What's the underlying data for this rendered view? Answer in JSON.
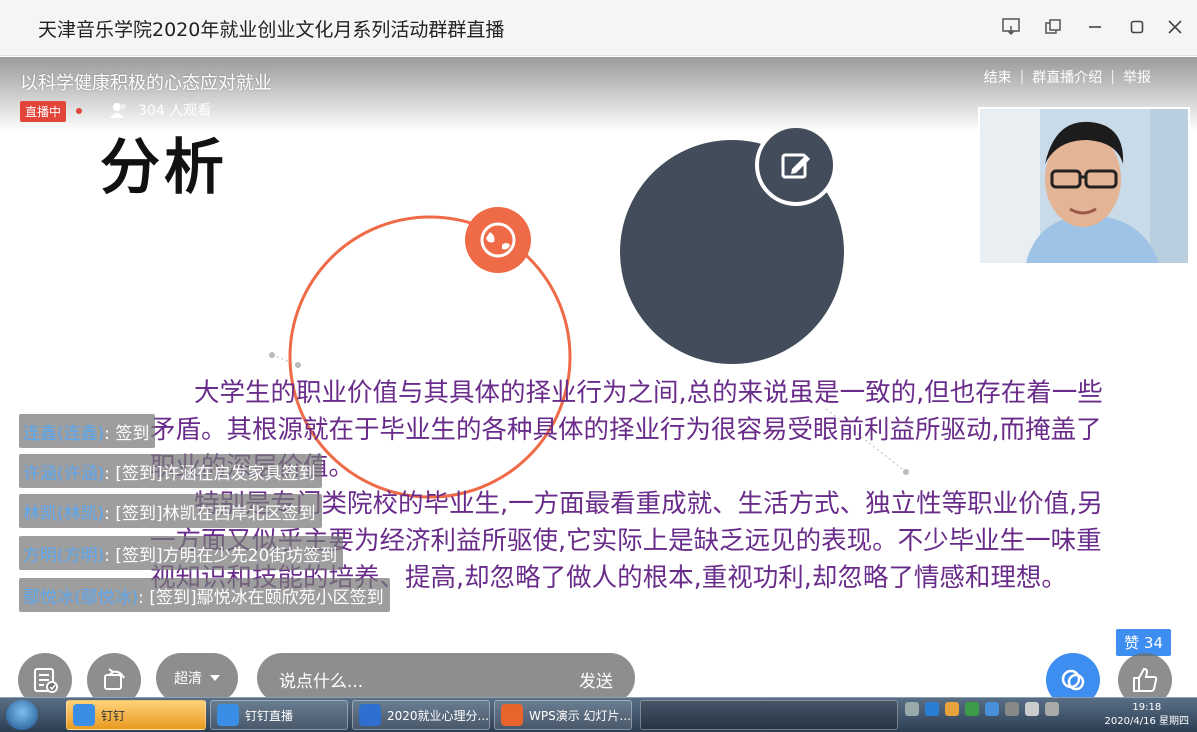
{
  "window": {
    "title": "天津音乐学院2020年就业创业文化月系列活动群群直播"
  },
  "live": {
    "title": "以科学健康积极的心态应对就业",
    "badge": "直播中",
    "viewers": "304 人观看",
    "links": [
      "结束",
      "群直播介绍",
      "举报"
    ],
    "separators": [
      "|",
      "|"
    ]
  },
  "slide": {
    "heading": "分析",
    "paragraphs": [
      "大学生的职业价值与其具体的择业行为之间,总的来说虽是一致的,但也存在着一些矛盾。其根源就在于毕业生的各种具体的择业行为很容易受眼前利益所驱动,而掩盖了职业的深层价值。",
      "特别是专门类院校的毕业生,一方面最看重成就、生活方式、独立性等职业价值,另一方面又似乎主要为经济利益所驱使,它实际上是缺乏远见的表现。不少毕业生一味重视知识和技能的培养、提高,却忽略了做人的根本,重视功利,却忽略了情感和理想。"
    ]
  },
  "chat": [
    {
      "nick": "连鑫(连鑫)",
      "msg": " : 签到"
    },
    {
      "nick": "许涵(许涵)",
      "msg": " : [签到]许涵在启发家具签到"
    },
    {
      "nick": "林凯(林凯)",
      "msg": " : [签到]林凯在西岸北区签到"
    },
    {
      "nick": "方明(方明)",
      "msg": " : [签到]方明在少先20街坊签到"
    },
    {
      "nick": "鄢悦冰(鄢悦冰)",
      "msg": " : [签到]鄢悦冰在颐欣苑小区签到"
    }
  ],
  "controls": {
    "quality": "超清",
    "comment_placeholder": "说点什么...",
    "send": "发送",
    "like_count": "赞 34"
  },
  "taskbar": {
    "items": [
      "钉钉",
      "钉钉直播",
      "2020就业心理分...",
      "WPS演示 幻灯片..."
    ],
    "search": "",
    "time": "19:18",
    "date": "2020/4/16 星期四"
  },
  "colors": {
    "accent": "#3d8ef0",
    "live_red": "#e4453a",
    "slide_text": "#6a2c8a",
    "chat_nick": "#5aa6f0",
    "circle_orange": "#ef6a47",
    "circle_dark": "#434c5a"
  }
}
